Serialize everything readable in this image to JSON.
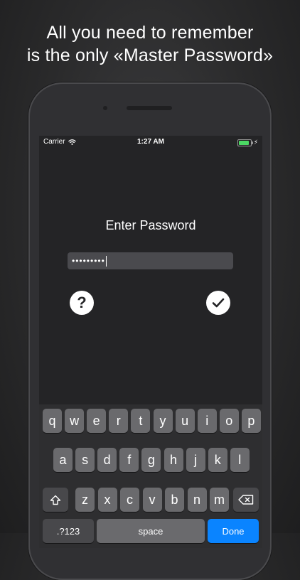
{
  "headline": {
    "line1": "All you need to remember",
    "line2": "is the only «Master Password»"
  },
  "statusbar": {
    "carrier": "Carrier",
    "time": "1:27 AM",
    "battery_level": 0.9
  },
  "login": {
    "title": "Enter Password",
    "password_value": "•••••••••",
    "help_label": "?"
  },
  "keyboard": {
    "row1": [
      "q",
      "w",
      "e",
      "r",
      "t",
      "y",
      "u",
      "i",
      "o",
      "p"
    ],
    "row2": [
      "a",
      "s",
      "d",
      "f",
      "g",
      "h",
      "j",
      "k",
      "l"
    ],
    "row3": [
      "z",
      "x",
      "c",
      "v",
      "b",
      "n",
      "m"
    ],
    "numbers_label": ".?123",
    "space_label": "space",
    "done_label": "Done"
  },
  "colors": {
    "accent": "#0a84ff",
    "battery": "#4cd964"
  },
  "icons": {
    "wifi": "wifi-icon",
    "checkmark": "checkmark-icon",
    "shift": "shift-icon",
    "backspace": "backspace-icon"
  }
}
